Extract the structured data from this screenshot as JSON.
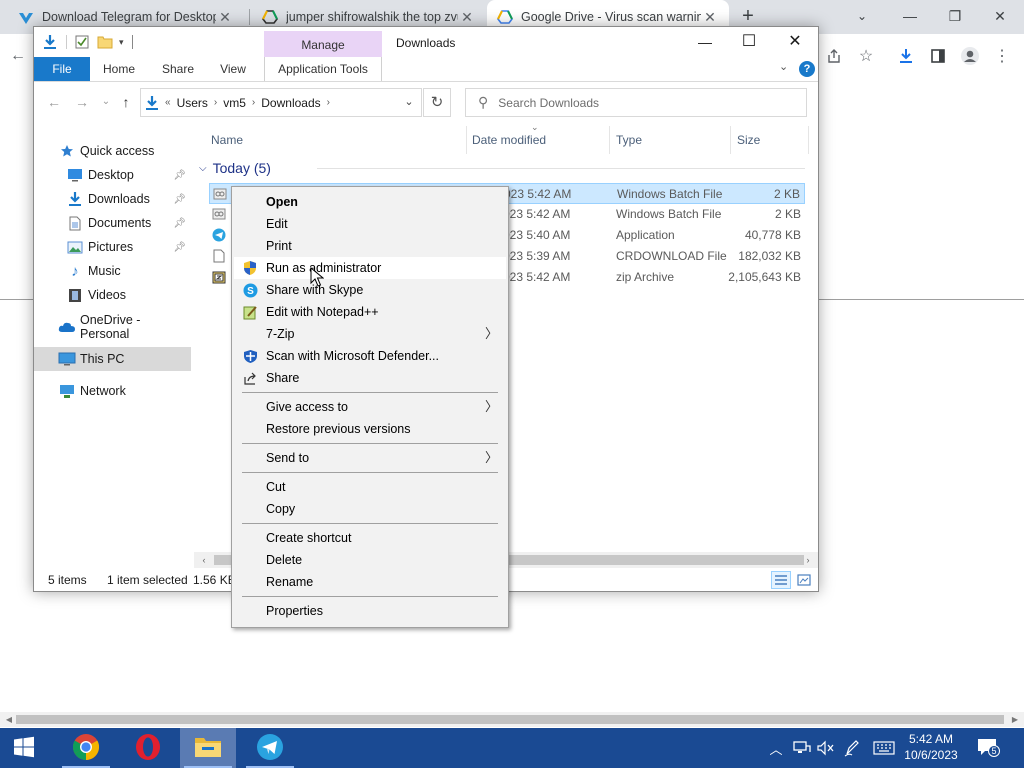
{
  "chrome": {
    "tabs": [
      {
        "title": "Download Telegram for Desktop",
        "close": "✕"
      },
      {
        "title": "jumper shifrowalshik the top zvuk",
        "close": "✕"
      },
      {
        "title": "Google Drive - Virus scan warning",
        "close": "✕"
      }
    ],
    "new_tab": "+",
    "window_controls": {
      "minimize": "—",
      "restore": "❐",
      "close": "✕"
    }
  },
  "explorer": {
    "title": "Downloads",
    "contextual_tab_group": "Manage",
    "ribbon_tabs": [
      "File",
      "Home",
      "Share",
      "View",
      "Application Tools"
    ],
    "help": "?",
    "window_controls": {
      "minimize": "—",
      "maximize": "☐",
      "close": "✕"
    },
    "address": {
      "overflow": "«",
      "crumbs": [
        "Users",
        "vm5",
        "Downloads"
      ]
    },
    "search_placeholder": "Search Downloads",
    "nav_pane": [
      {
        "label": "Quick access",
        "icon": "star-icon",
        "pinned": false
      },
      {
        "label": "Desktop",
        "icon": "desktop-icon",
        "pinned": true
      },
      {
        "label": "Downloads",
        "icon": "download-icon",
        "pinned": true
      },
      {
        "label": "Documents",
        "icon": "documents-icon",
        "pinned": true
      },
      {
        "label": "Pictures",
        "icon": "pictures-icon",
        "pinned": true
      },
      {
        "label": "Music",
        "icon": "music-icon",
        "pinned": false
      },
      {
        "label": "Videos",
        "icon": "videos-icon",
        "pinned": false
      },
      {
        "label": "OneDrive - Personal",
        "icon": "onedrive-icon",
        "pinned": false
      },
      {
        "label": "This PC",
        "icon": "this-pc-icon",
        "pinned": false,
        "selected": true
      },
      {
        "label": "Network",
        "icon": "network-icon",
        "pinned": false
      }
    ],
    "columns": [
      "Name",
      "Date modified",
      "Type",
      "Size"
    ],
    "group": {
      "label": "Today (5)"
    },
    "files": [
      {
        "date": "023 5:42 AM",
        "type": "Windows Batch File",
        "size": "2 KB",
        "selected": true,
        "icon": "batch-file-icon"
      },
      {
        "date": "023 5:42 AM",
        "type": "Windows Batch File",
        "size": "2 KB",
        "selected": false,
        "icon": "batch-file-icon"
      },
      {
        "date": "023 5:40 AM",
        "type": "Application",
        "size": "40,778 KB",
        "selected": false,
        "icon": "telegram-icon"
      },
      {
        "date": "023 5:39 AM",
        "type": "CRDOWNLOAD File",
        "size": "182,032 KB",
        "selected": false,
        "icon": "blank-file-icon"
      },
      {
        "date": "023 5:42 AM",
        "type": "zip Archive",
        "size": "2,105,643 KB",
        "selected": false,
        "icon": "zip-icon"
      }
    ],
    "status": {
      "items": "5 items",
      "selected": "1 item selected",
      "size": "1.56 KB"
    }
  },
  "context_menu": {
    "groups": [
      [
        {
          "label": "Open",
          "bold": true
        },
        {
          "label": "Edit"
        },
        {
          "label": "Print"
        },
        {
          "label": "Run as administrator",
          "icon": "uac-shield-icon",
          "hover": true
        },
        {
          "label": "Share with Skype",
          "icon": "skype-icon"
        },
        {
          "label": "Edit with Notepad++",
          "icon": "notepadpp-icon"
        },
        {
          "label": "7-Zip",
          "submenu": true
        },
        {
          "label": "Scan with Microsoft Defender...",
          "icon": "defender-icon"
        },
        {
          "label": "Share",
          "icon": "share-icon"
        }
      ],
      [
        {
          "label": "Give access to",
          "submenu": true
        },
        {
          "label": "Restore previous versions"
        }
      ],
      [
        {
          "label": "Send to",
          "submenu": true
        }
      ],
      [
        {
          "label": "Cut"
        },
        {
          "label": "Copy"
        }
      ],
      [
        {
          "label": "Create shortcut"
        },
        {
          "label": "Delete"
        },
        {
          "label": "Rename"
        }
      ],
      [
        {
          "label": "Properties"
        }
      ]
    ]
  },
  "taskbar": {
    "apps": [
      "start-icon",
      "chrome-icon",
      "opera-icon",
      "file-explorer-icon",
      "telegram-icon"
    ],
    "clock": {
      "time": "5:42 AM",
      "date": "10/6/2023"
    },
    "notifications": "5"
  },
  "colors": {
    "accent": "#1979ca",
    "manage_tab": "#e9d4f6",
    "selection": "#cce8ff",
    "taskbar": "#1a4a93"
  }
}
